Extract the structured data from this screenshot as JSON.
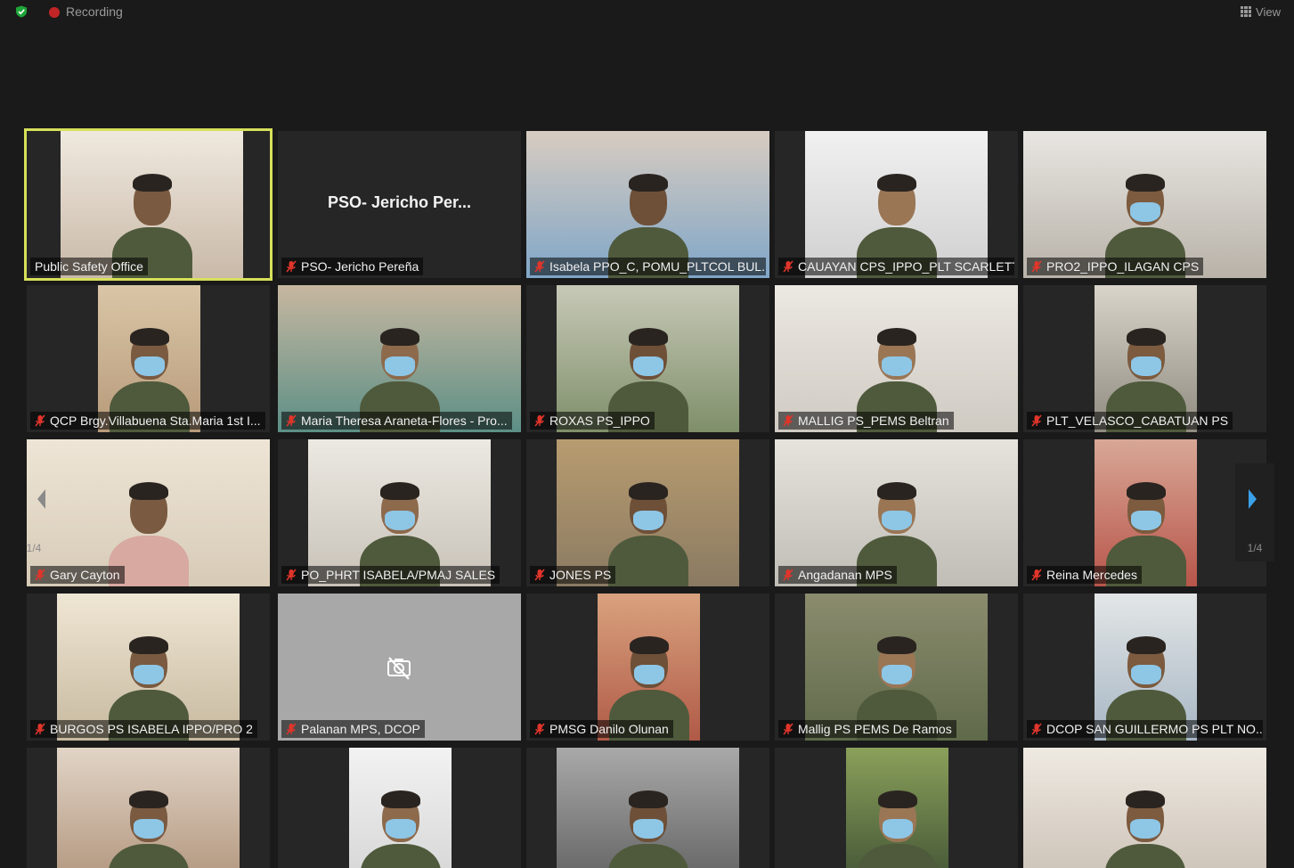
{
  "topbar": {
    "recording_label": "Recording",
    "view_label": "View",
    "shield_icon": "green-shield-icon",
    "recording_icon": "red-record-dot-icon"
  },
  "pager": {
    "left_page": "1/4",
    "right_page": "1/4",
    "left_icon": "chevron-left-icon",
    "right_icon": "chevron-right-icon"
  },
  "participants": [
    {
      "name": "Public Safety Office",
      "muted": false,
      "kind": "video",
      "active": true
    },
    {
      "name": "PSO- Jericho Pereña",
      "muted": true,
      "kind": "name",
      "display_name": "PSO- Jericho Per..."
    },
    {
      "name": "Isabela PPO_C, POMU_PLTCOL BUL...",
      "muted": true,
      "kind": "video"
    },
    {
      "name": "CAUAYAN CPS_IPPO_PLT SCARLETT...",
      "muted": true,
      "kind": "video"
    },
    {
      "name": "PRO2_IPPO_ILAGAN CPS",
      "muted": true,
      "kind": "video"
    },
    {
      "name": "QCP Brgy.Villabuena Sta.Maria 1st I...",
      "muted": true,
      "kind": "video"
    },
    {
      "name": "Maria Theresa Araneta-Flores - Pro...",
      "muted": true,
      "kind": "video"
    },
    {
      "name": "ROXAS PS_IPPO",
      "muted": true,
      "kind": "video"
    },
    {
      "name": "MALLIG PS_PEMS Beltran",
      "muted": true,
      "kind": "video"
    },
    {
      "name": "PLT_VELASCO_CABATUAN PS",
      "muted": true,
      "kind": "video"
    },
    {
      "name": "Gary Cayton",
      "muted": true,
      "kind": "video"
    },
    {
      "name": "PO_PHRT ISABELA/PMAJ SALES",
      "muted": true,
      "kind": "video"
    },
    {
      "name": "JONES PS",
      "muted": true,
      "kind": "video"
    },
    {
      "name": "Angadanan MPS",
      "muted": true,
      "kind": "video"
    },
    {
      "name": "Reina Mercedes",
      "muted": true,
      "kind": "video"
    },
    {
      "name": "BURGOS PS ISABELA IPPO/PRO 2",
      "muted": true,
      "kind": "video"
    },
    {
      "name": "Palanan MPS, DCOP",
      "muted": true,
      "kind": "camoff"
    },
    {
      "name": "PMSG Danilo Olunan",
      "muted": true,
      "kind": "video"
    },
    {
      "name": "Mallig PS PEMS De Ramos",
      "muted": true,
      "kind": "video"
    },
    {
      "name": "DCOP SAN GUILLERMO PS PLT NO...",
      "muted": true,
      "kind": "video"
    },
    {
      "name": "",
      "muted": false,
      "kind": "video"
    },
    {
      "name": "",
      "muted": false,
      "kind": "video"
    },
    {
      "name": "",
      "muted": false,
      "kind": "video"
    },
    {
      "name": "",
      "muted": false,
      "kind": "video"
    },
    {
      "name": "",
      "muted": false,
      "kind": "video"
    }
  ],
  "colors": {
    "background": "#1a1a1a",
    "tile": "#262626",
    "active_speaker_border": "#d6e05a",
    "muted_mic": "#e0352b",
    "pager_arrow_right": "#3aa0e8",
    "pager_arrow_left": "#8a8a8a"
  }
}
